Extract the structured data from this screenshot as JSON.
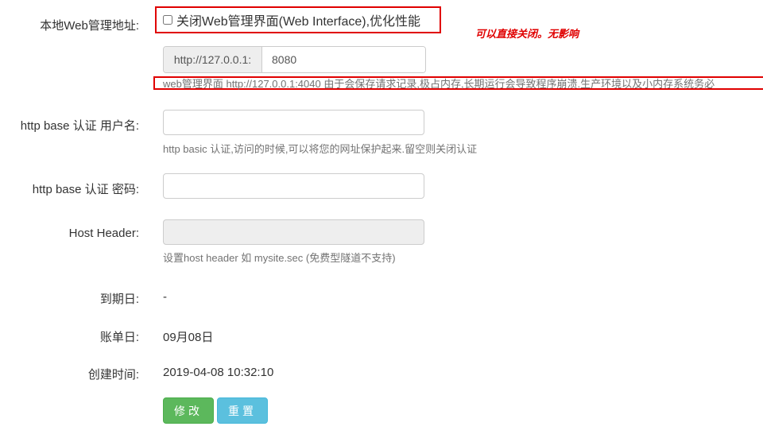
{
  "web_admin": {
    "label": "本地Web管理地址:",
    "checkbox_label": "关闭Web管理界面(Web Interface),优化性能",
    "checked": false,
    "annotation": "可以直接关闭。无影响",
    "addon": "http://127.0.0.1:",
    "port": "8080",
    "help": "web管理界面 http://127.0.0.1:4040 由于会保存请求记录,极占内存,长期运行会导致程序崩溃.生产环境以及小内存系统务必"
  },
  "auth_user": {
    "label": "http base 认证 用户名:",
    "value": "",
    "help": "http basic 认证,访问的时候,可以将您的网址保护起来.留空则关闭认证"
  },
  "auth_pass": {
    "label": "http base 认证 密码:",
    "value": ""
  },
  "host_header": {
    "label": "Host Header:",
    "value": "",
    "help": "设置host header 如 mysite.sec (免费型隧道不支持)"
  },
  "expiry": {
    "label": "到期日:",
    "value": "-"
  },
  "billing": {
    "label": "账单日:",
    "value": "09月08日"
  },
  "created": {
    "label": "创建时间:",
    "value": "2019-04-08 10:32:10"
  },
  "buttons": {
    "submit": "修改",
    "reset": "重置"
  },
  "colors": {
    "highlight": "#e00000",
    "submit": "#5cb85c",
    "reset": "#5bc0de"
  }
}
